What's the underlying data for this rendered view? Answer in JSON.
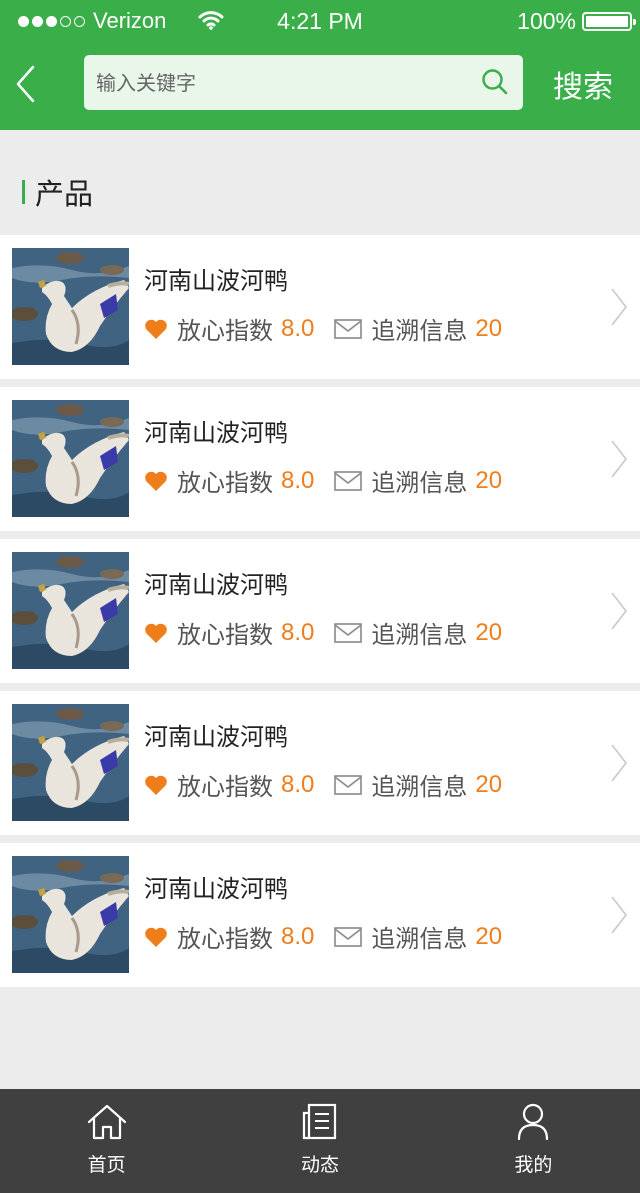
{
  "status_bar": {
    "carrier": "Verizon",
    "time": "4:21 PM",
    "battery": "100%"
  },
  "header": {
    "search_placeholder": "输入关键字",
    "search_button": "搜索"
  },
  "section": {
    "title": "产品"
  },
  "products": [
    {
      "name": "河南山波河鸭",
      "trust_label": "放心指数",
      "trust_value": "8.0",
      "trace_label": "追溯信息",
      "trace_value": "20"
    },
    {
      "name": "河南山波河鸭",
      "trust_label": "放心指数",
      "trust_value": "8.0",
      "trace_label": "追溯信息",
      "trace_value": "20"
    },
    {
      "name": "河南山波河鸭",
      "trust_label": "放心指数",
      "trust_value": "8.0",
      "trace_label": "追溯信息",
      "trace_value": "20"
    },
    {
      "name": "河南山波河鸭",
      "trust_label": "放心指数",
      "trust_value": "8.0",
      "trace_label": "追溯信息",
      "trace_value": "20"
    },
    {
      "name": "河南山波河鸭",
      "trust_label": "放心指数",
      "trust_value": "8.0",
      "trace_label": "追溯信息",
      "trace_value": "20"
    }
  ],
  "tabs": [
    {
      "label": "首页",
      "icon": "home-icon"
    },
    {
      "label": "动态",
      "icon": "news-icon"
    },
    {
      "label": "我的",
      "icon": "user-icon"
    }
  ],
  "colors": {
    "brand_green": "#3aae49",
    "accent_orange": "#ef7d1a",
    "tabbar_bg": "#404040"
  }
}
